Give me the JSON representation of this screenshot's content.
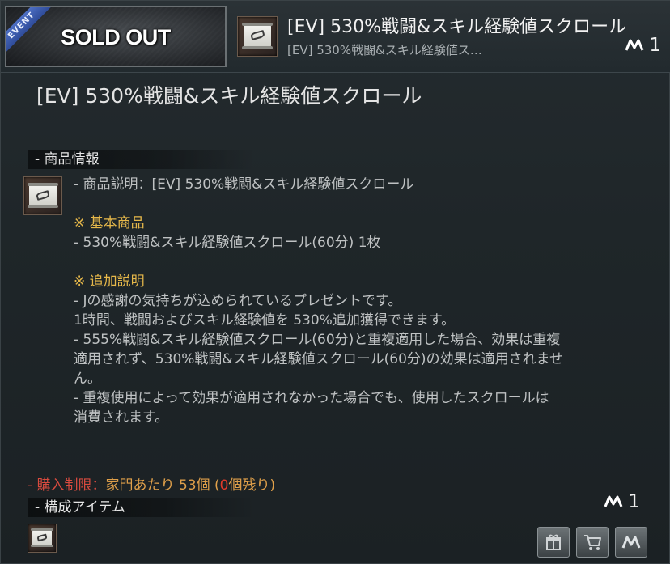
{
  "header": {
    "event_badge": "EVENT",
    "status": "SOLD OUT",
    "title": "[EV] 530%戦闘&スキル経験値スクロール",
    "subtitle": "[EV] 530%戦闘&スキル経験値ス…",
    "price": "1",
    "currency_icon": "pearl-currency-icon"
  },
  "main_title": "[EV] 530%戦闘&スキル経験値スクロール",
  "product_info": {
    "section_label": "- 商品情報",
    "description": "- 商品説明：[EV] 530%戦闘&スキル経験値スクロール",
    "basic_heading": "※ 基本商品",
    "basic_item": "- 530%戦闘&スキル経験値スクロール(60分) 1枚",
    "extra_heading": "※ 追加説明",
    "extra_lines": [
      "- Jの感謝の気持ちが込められているプレゼントです。",
      "1時間、戦闘およびスキル経験値を 530%追加獲得できます。",
      "- 555%戦闘&スキル経験値スクロール(60分)と重複適用した場合、効果は重複",
      "適用されず、530%戦闘&スキル経験値スクロール(60分)の効果は適用されませ",
      "ん。",
      "- 重複使用によって効果が適用されなかった場合でも、使用したスクロールは",
      "消費されます。"
    ]
  },
  "purchase_limit": {
    "prefix": "- 購入制限：",
    "family": "家門あたり 53個 (",
    "remaining": "0",
    "suffix": "個残り)"
  },
  "components": {
    "section_label": "- 構成アイテム"
  },
  "bottom_price": "1",
  "buttons": {
    "gift": "gift-icon",
    "cart": "cart-icon",
    "buy": "pearl-buy-icon"
  },
  "colors": {
    "accent_yellow": "#e6b84a",
    "limit_red": "#d84b3f",
    "event_blue": "#3b5db0"
  }
}
